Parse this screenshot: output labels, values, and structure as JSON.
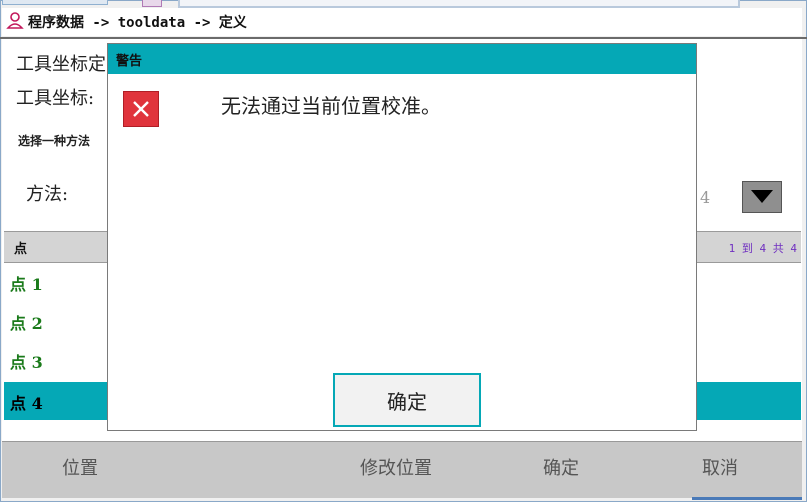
{
  "window": {
    "title": "程序数据 -> tooldata -> 定义"
  },
  "form": {
    "tool_frame_label": "工具坐标定",
    "tool_coord_label": "工具坐标:",
    "choose_method_label": "选择一种方法",
    "method_label": "方法:",
    "method_value": "4"
  },
  "list": {
    "header": "点",
    "count": "1 到 4 共 4",
    "rows": [
      {
        "label": "点  1"
      },
      {
        "label": "点  2"
      },
      {
        "label": "点  3"
      },
      {
        "label": "点  4"
      }
    ],
    "selected_index": 3
  },
  "bottom_bar": {
    "position": "位置",
    "modify_position": "修改位置",
    "confirm": "确定",
    "cancel": "取消"
  },
  "dialog": {
    "title": "警告",
    "message": "无法通过当前位置校准。",
    "ok": "确定",
    "icon": "error-x-icon"
  },
  "colors": {
    "accent": "#05a8b6",
    "error": "#e0343c",
    "row_text": "#1a7a1a"
  }
}
